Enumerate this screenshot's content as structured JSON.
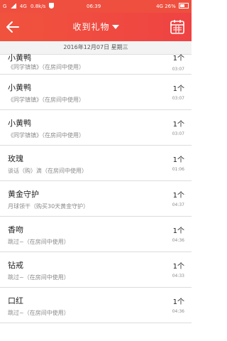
{
  "status_bar": {
    "carrier": "G",
    "network": "4G",
    "speed": "0.8k/s",
    "time": "06:39",
    "right_info": "4G 26%"
  },
  "header": {
    "title": "收到礼物"
  },
  "date_bar": {
    "date": "2016年12月07日",
    "weekday": "星期三"
  },
  "gifts": [
    {
      "name": "小黄鸭",
      "detail": "《同学镇镇》（在房间中使用）",
      "count": "1个",
      "time": "03:07"
    },
    {
      "name": "小黄鸭",
      "detail": "《同学镇镇》（在房间中使用）",
      "count": "1个",
      "time": "03:07"
    },
    {
      "name": "小黄鸭",
      "detail": "《同学镇镇》（在房间中使用）",
      "count": "1个",
      "time": "03:07"
    },
    {
      "name": "玫瑰",
      "detail": "谈话（购）滴（在房间中使用）",
      "count": "1个",
      "time": "01:06"
    },
    {
      "name": "黄金守护",
      "detail": "月球领干（购买30天黄金守护）",
      "count": "1个",
      "time": "04:37"
    },
    {
      "name": "香吻",
      "detail": "跳过~（在房间中使用）",
      "count": "1个",
      "time": "04:36"
    },
    {
      "name": "钻戒",
      "detail": "跳过~（在房间中使用）",
      "count": "1个",
      "time": "04:33"
    },
    {
      "name": "口红",
      "detail": "跳过~（在房间中使用）",
      "count": "1个",
      "time": "04:36"
    }
  ],
  "colors": {
    "header_bg": "#ef4a3f",
    "text": "#222222",
    "muted": "#8a8a8a"
  }
}
